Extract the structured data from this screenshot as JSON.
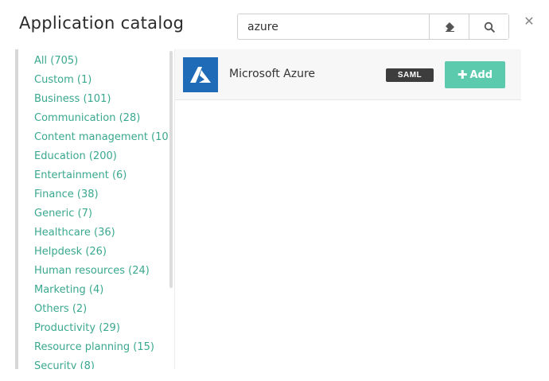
{
  "dialog": {
    "title": "Application catalog",
    "close_icon": "close-icon"
  },
  "search": {
    "value": "azure",
    "clear_icon": "eraser-icon",
    "search_icon": "search-icon"
  },
  "categories": [
    {
      "label": "All (705)"
    },
    {
      "label": "Custom (1)"
    },
    {
      "label": "Business (101)"
    },
    {
      "label": "Communication (28)"
    },
    {
      "label": "Content management (10)"
    },
    {
      "label": "Education (200)"
    },
    {
      "label": "Entertainment (6)"
    },
    {
      "label": "Finance (38)"
    },
    {
      "label": "Generic (7)"
    },
    {
      "label": "Healthcare (36)"
    },
    {
      "label": "Helpdesk (26)"
    },
    {
      "label": "Human resources (24)"
    },
    {
      "label": "Marketing (4)"
    },
    {
      "label": "Others (2)"
    },
    {
      "label": "Productivity (29)"
    },
    {
      "label": "Resource planning (15)"
    },
    {
      "label": "Security (8)"
    }
  ],
  "results": [
    {
      "name": "Microsoft Azure",
      "logo_icon": "azure-logo-icon",
      "badge": "SAML",
      "add_label": "Add",
      "add_icon": "plus-icon"
    }
  ],
  "colors": {
    "accent": "#5ccbad",
    "link": "#3aa88f",
    "logo_bg": "#1f6bb8",
    "badge_bg": "#3d3d3d"
  }
}
